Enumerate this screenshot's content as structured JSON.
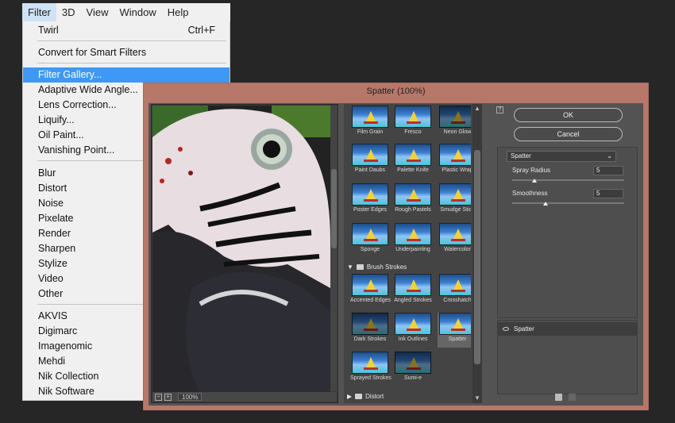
{
  "menubar": {
    "items": [
      "Filter",
      "3D",
      "View",
      "Window",
      "Help"
    ]
  },
  "dropdown": {
    "items": [
      {
        "label": "Twirl",
        "shortcut": "Ctrl+F"
      },
      {
        "label": "Convert for Smart Filters"
      },
      {
        "label": "Filter Gallery..."
      },
      {
        "label": "Adaptive Wide Angle..."
      },
      {
        "label": "Lens Correction..."
      },
      {
        "label": "Liquify..."
      },
      {
        "label": "Oil Paint..."
      },
      {
        "label": "Vanishing Point..."
      },
      {
        "label": "Blur"
      },
      {
        "label": "Distort"
      },
      {
        "label": "Noise"
      },
      {
        "label": "Pixelate"
      },
      {
        "label": "Render"
      },
      {
        "label": "Sharpen"
      },
      {
        "label": "Stylize"
      },
      {
        "label": "Video"
      },
      {
        "label": "Other"
      },
      {
        "label": "AKVIS"
      },
      {
        "label": "Digimarc"
      },
      {
        "label": "Imagenomic"
      },
      {
        "label": "Mehdi"
      },
      {
        "label": "Nik Collection"
      },
      {
        "label": "Nik Software"
      }
    ]
  },
  "dialog": {
    "title": "Spatter (100%)",
    "zoom": "100%",
    "thumbnails_artistic": [
      "Film Grain",
      "Fresco",
      "Neon Glow",
      "Paint Daubs",
      "Palette Knife",
      "Plastic Wrap",
      "Poster Edges",
      "Rough Pastels",
      "Smudge Stick",
      "Sponge",
      "Underpainting",
      "Watercolor"
    ],
    "category_brush": "Brush Strokes",
    "thumbnails_brush": [
      "Accented Edges",
      "Angled Strokes",
      "Crosshatch",
      "Dark Strokes",
      "Ink Outlines",
      "Spatter",
      "Sprayed Strokes",
      "Sumi-e"
    ],
    "category_distort": "Distort",
    "ok_label": "OK",
    "cancel_label": "Cancel",
    "filter_select": "Spatter",
    "spray_radius_label": "Spray Radius",
    "spray_radius_value": "5",
    "spray_radius_fraction": 0.2,
    "smoothness_label": "Smoothness",
    "smoothness_value": "5",
    "smoothness_fraction": 0.3,
    "layer_name": "Spatter"
  },
  "colors": {
    "highlight": "#3d99f5",
    "dialog_frame": "#b77769"
  }
}
